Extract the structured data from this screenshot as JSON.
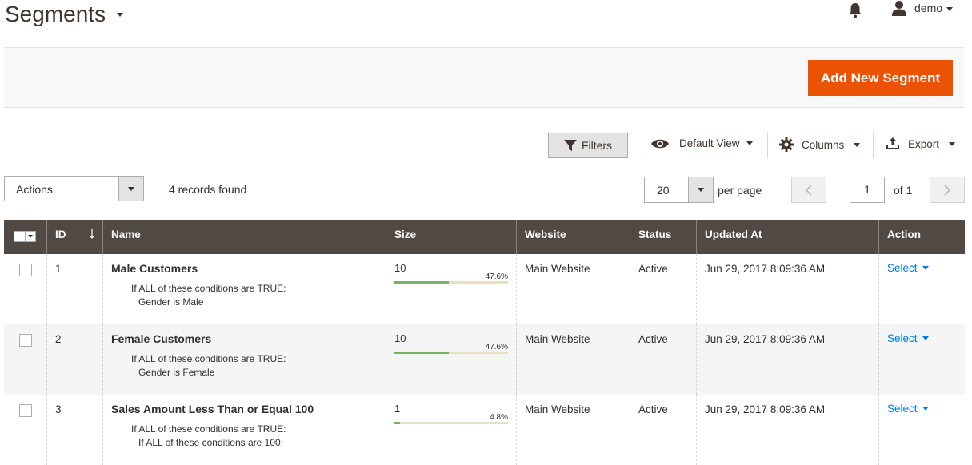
{
  "header": {
    "title": "Segments",
    "user_name": "demo"
  },
  "page_actions": {
    "add_button": "Add New Segment"
  },
  "toolbar": {
    "filters": "Filters",
    "view": "Default View",
    "columns": "Columns",
    "export": "Export",
    "actions": "Actions",
    "records_found": "4 records found",
    "per_page_value": "20",
    "per_page_label": "per page",
    "page_current": "1",
    "page_total": "of 1"
  },
  "grid": {
    "columns": [
      "ID",
      "Name",
      "Size",
      "Website",
      "Status",
      "Updated At",
      "Action"
    ],
    "rows": [
      {
        "id": "1",
        "name": "Male Customers",
        "cond1": "If ALL of these conditions are TRUE:",
        "cond2": "Gender is Male",
        "size": "10",
        "pct": "47.6%",
        "fill": 0.476,
        "website": "Main Website",
        "status": "Active",
        "updated": "Jun 29, 2017 8:09:36 AM",
        "action": "Select"
      },
      {
        "id": "2",
        "name": "Female Customers",
        "cond1": "If ALL of these conditions are TRUE:",
        "cond2": "Gender is Female",
        "size": "10",
        "pct": "47.6%",
        "fill": 0.476,
        "website": "Main Website",
        "status": "Active",
        "updated": "Jun 29, 2017 8:09:36 AM",
        "action": "Select"
      },
      {
        "id": "3",
        "name": "Sales Amount Less Than or Equal 100",
        "cond1": "If ALL of these conditions are TRUE:",
        "cond2": "If ALL of these conditions are 100:",
        "size": "1",
        "pct": "4.8%",
        "fill": 0.048,
        "website": "Main Website",
        "status": "Active",
        "updated": "Jun 29, 2017 8:09:36 AM",
        "action": "Select"
      }
    ]
  }
}
